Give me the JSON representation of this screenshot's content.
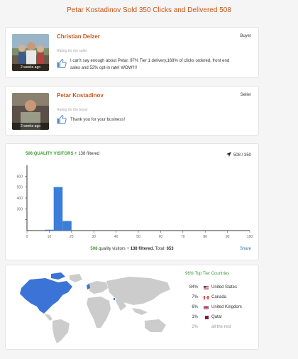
{
  "page_title": "Petar Kostadinov Sold 350 Clicks and Delivered 508",
  "reviews": [
    {
      "name": "Christian Delzer",
      "role": "Buyer",
      "rating_label": "Rating for the seller",
      "text_line1": "I can't say enough about Petar. 97% Tier 1 delivery,168% of clicks ordered, front end",
      "text_line2": "sales and 52% opt-in rate! WOW!!!!",
      "avatar_caption": "2 weeks ago"
    },
    {
      "name": "Petar Kostadinov",
      "role": "Seller",
      "rating_label": "Rating for the buyer",
      "text_line1": "Thank you for your business!",
      "avatar_caption": "2 weeks ago"
    }
  ],
  "stats": {
    "quality_count": "508",
    "quality_label": "QUALITY VISITORS",
    "filtered_text": "+ 138 filtered",
    "counter": "508 / 350",
    "summary_quality": "508",
    "summary_mid": "quality visitors +",
    "summary_filtered": "138 filtered.",
    "summary_total_label": "Total:",
    "summary_total": "653",
    "share_label": "Share"
  },
  "chart_data": {
    "type": "bar",
    "x": [
      10,
      14,
      18
    ],
    "values": [
      8,
      400,
      88
    ],
    "bar_width": 4,
    "xlim": [
      0,
      100
    ],
    "ylim": [
      0,
      600
    ],
    "xticks": [
      0,
      10,
      20,
      30,
      40,
      50,
      60,
      70,
      80,
      90,
      100
    ],
    "yticks": [
      100,
      200,
      300,
      400,
      500
    ],
    "ytick_labels": [
      "",
      "300",
      "400",
      "500",
      "600"
    ],
    "bar_color": "#3b7dd8"
  },
  "countries": {
    "title": "96% Top Tier Countries",
    "rows": [
      {
        "pct": "84%",
        "name": "United States",
        "flag": "us"
      },
      {
        "pct": "7%",
        "name": "Canada",
        "flag": "ca"
      },
      {
        "pct": "6%",
        "name": "United Kingdom",
        "flag": "uk"
      },
      {
        "pct": "1%",
        "name": "Qatar",
        "flag": "qa"
      },
      {
        "pct": "2%",
        "name": "all the rest",
        "flag": ""
      }
    ]
  },
  "colors": {
    "accent": "#c8551a",
    "green": "#3a9c2f",
    "bar": "#3b7dd8",
    "map_land": "#cccccc",
    "map_highlight": "#3b73d6"
  }
}
